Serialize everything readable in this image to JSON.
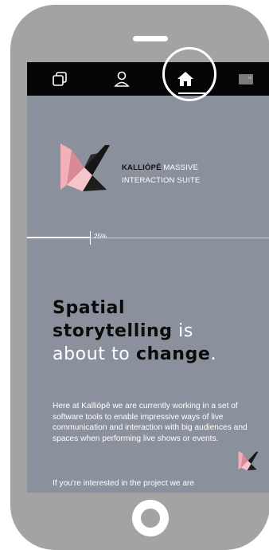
{
  "app": {
    "brand_strong": "KALLIÓPÊ",
    "brand_rest": "MASSIVE",
    "brand_line2": "INTERACTION SUITE"
  },
  "nav": {
    "items": [
      {
        "icon": "copy-icon"
      },
      {
        "icon": "user-icon"
      },
      {
        "icon": "home-icon",
        "active": true
      },
      {
        "icon": "window-icon"
      }
    ]
  },
  "progress": {
    "label": "25%",
    "value": 0.25
  },
  "headline": {
    "line1_dark": "Spatial",
    "line2_dark": "storytelling",
    "line2_light": " is",
    "line3_light": "about to ",
    "line3_dark": "change",
    "line3_end": "."
  },
  "body": {
    "paragraph1": "Here at Kalliópê we are currently working in a set of software tools to enable impressive ways of live communication and interaction with big audiences and spaces when performing live shows or events.",
    "paragraph2": "If you're interested in the project we are"
  },
  "colors": {
    "bezel": "#a3a3a3",
    "topbar": "#050505",
    "screen_bg": "#8b919c",
    "logo_pink": "#f4b6be",
    "logo_dark": "#161616"
  }
}
